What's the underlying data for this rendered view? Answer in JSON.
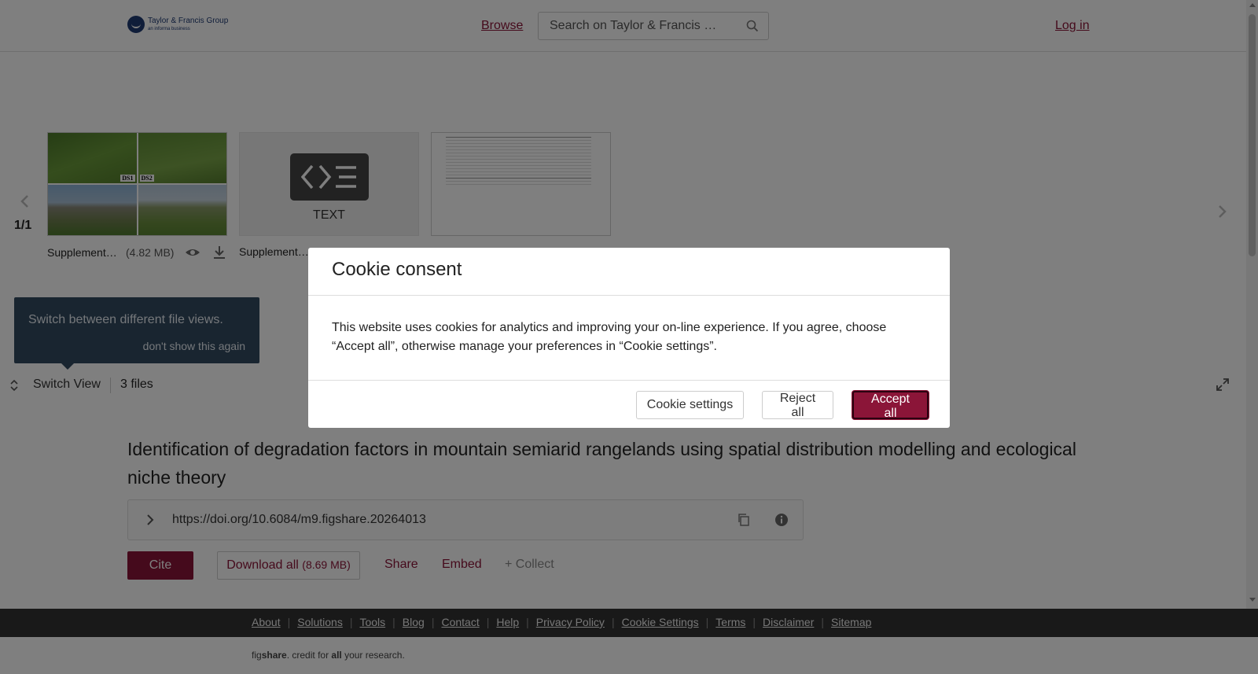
{
  "header": {
    "logo_main": "Taylor & Francis Group",
    "logo_sub": "an informa business",
    "browse_label": "Browse",
    "search_placeholder": "Search on Taylor & Francis …",
    "login_label": "Log in"
  },
  "viewer": {
    "counter": "1/1",
    "files": [
      {
        "name": "Supplemental…",
        "size": "(4.82 MB)",
        "thumb_labels": [
          "DS1",
          "DS2"
        ]
      },
      {
        "name": "Supplement…",
        "type_label": "TEXT"
      },
      {
        "name": ""
      }
    ],
    "tooltip": {
      "text": "Switch between different file views.",
      "dismiss": "don't show this again"
    },
    "switch_view_label": "Switch View",
    "files_count": "3 files"
  },
  "article": {
    "title": "Identification of degradation factors in mountain semiarid rangelands using spatial distribution modelling and ecological niche theory",
    "doi": "https://doi.org/10.6084/m9.figshare.20264013",
    "actions": {
      "cite": "Cite",
      "download_all": "Download all",
      "download_size": "(8.69 MB)",
      "share": "Share",
      "embed": "Embed",
      "collect": "+ Collect"
    }
  },
  "footer": {
    "links": [
      "About",
      "Solutions",
      "Tools",
      "Blog",
      "Contact",
      "Help",
      "Privacy Policy",
      "Cookie Settings",
      "Terms",
      "Disclaimer",
      "Sitemap"
    ],
    "tagline_fig": "fig",
    "tagline_share": "share",
    "tagline_mid": ". credit for ",
    "tagline_all": "all",
    "tagline_end": " your research."
  },
  "cookie_modal": {
    "title": "Cookie consent",
    "body": "This website uses cookies for analytics and improving your on-line experience. If you agree, choose “Accept all”, otherwise manage your preferences in “Cookie settings”.",
    "settings_label": "Cookie settings",
    "reject_label": "Reject all",
    "accept_label": "Accept all"
  },
  "colors": {
    "brand": "#8b1538",
    "tooltip_bg": "#334a61",
    "footer_bg": "#333333"
  }
}
